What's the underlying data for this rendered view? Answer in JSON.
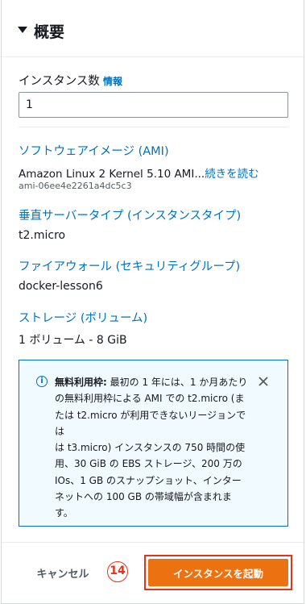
{
  "summary": {
    "title": "概要",
    "instance_count_label": "インスタンス数",
    "info_link": "情報",
    "instance_count_value": "1",
    "ami": {
      "label": "ソフトウェアイメージ (AMI)",
      "value": "Amazon Linux 2 Kernel 5.10 AMI...",
      "read_more": "続きを読む",
      "id": "ami-06ee4e2261a4dc5c3"
    },
    "instance_type": {
      "label": "垂直サーバータイプ (インスタンスタイプ)",
      "value": "t2.micro"
    },
    "firewall": {
      "label": "ファイアウォール (セキュリティグループ)",
      "value": "docker-lesson6"
    },
    "storage": {
      "label": "ストレージ (ボリューム)",
      "value": "1 ボリューム - 8 GiB"
    }
  },
  "free_tier_notice": {
    "heading": "無料利用枠:",
    "lines": [
      " 最初の 1 年には、1 か月あたり",
      "の無料利用枠による AMI での t2.micro (ま",
      "たは t2.micro が利用できないリージョンでは",
      "は t3.micro) インスタンスの 750 時間の使",
      "用、30 GiB の EBS ストレージ、200 万の",
      "IOs、1 GB のスナップショット、インター",
      "ネットへの 100 GB の帯域幅が含まれま",
      "す。"
    ]
  },
  "footer": {
    "cancel_label": "キャンセル",
    "step_marker": "14",
    "launch_label": "インスタンスを起動"
  },
  "colors": {
    "link": "#0073bb",
    "primary_button": "#ec7211",
    "annotation": "#e5331a",
    "notice_bg": "#f1faff"
  }
}
